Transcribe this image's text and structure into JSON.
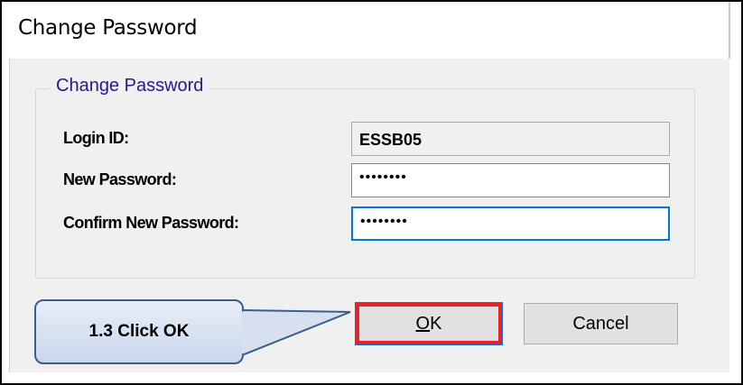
{
  "window": {
    "title": "Change Password"
  },
  "group": {
    "legend": "Change Password"
  },
  "fields": [
    {
      "label": "Login ID:",
      "value": "ESSB05"
    },
    {
      "label": "New Password:",
      "value": "••••••••"
    },
    {
      "label": "Confirm New Password:",
      "value": "••••••••"
    }
  ],
  "buttons": {
    "ok": {
      "label_underlined": "O",
      "label_rest": "K"
    },
    "cancel": "Cancel"
  },
  "annotation": {
    "callout_text": "1.3 Click OK",
    "highlight_color": "#e8202a",
    "callout_border_color": "#3b5f8a"
  }
}
